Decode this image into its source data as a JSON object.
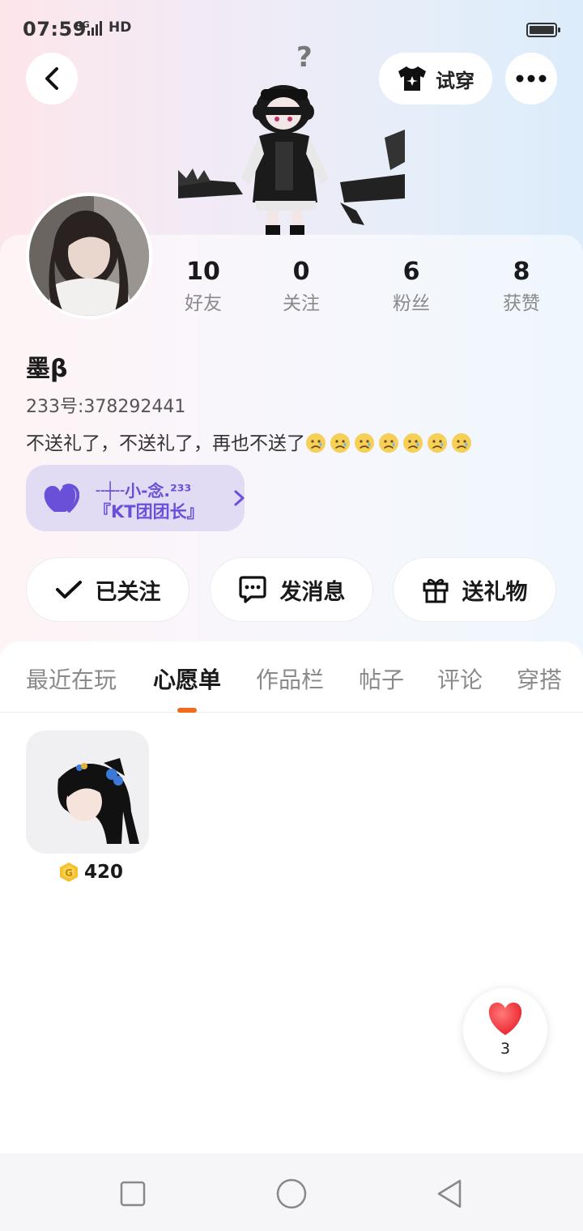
{
  "status_bar": {
    "time": "07:59",
    "network": "4G",
    "hd": "HD"
  },
  "header": {
    "back_icon": "chevron-left-icon",
    "tryon_label": "试穿",
    "tryon_icon": "tshirt-icon",
    "more_icon": "more-dots-icon"
  },
  "profile": {
    "stats": [
      {
        "value": "10",
        "label": "好友"
      },
      {
        "value": "0",
        "label": "关注"
      },
      {
        "value": "6",
        "label": "粉丝"
      },
      {
        "value": "8",
        "label": "获赞"
      }
    ],
    "username": "墨β",
    "uid": "233号:378292441",
    "bio": "不送礼了，不送礼了，再也不送了",
    "bio_emoji_count": 7,
    "tag": {
      "line1": "╌┼╌小-念.²³³",
      "line2": "『KT团团长』",
      "color": "#6a4fd8"
    }
  },
  "actions": [
    {
      "label": "已关注",
      "icon": "check-icon"
    },
    {
      "label": "发消息",
      "icon": "message-icon"
    },
    {
      "label": "送礼物",
      "icon": "gift-icon"
    }
  ],
  "tabs": [
    {
      "label": "最近在玩",
      "active": false
    },
    {
      "label": "心愿单",
      "active": true
    },
    {
      "label": "作品栏",
      "active": false
    },
    {
      "label": "帖子",
      "active": false
    },
    {
      "label": "评论",
      "active": false
    },
    {
      "label": "穿搭",
      "active": false
    }
  ],
  "wishlist": [
    {
      "price": "420",
      "currency_icon": "coin-icon"
    }
  ],
  "like_fab": {
    "count": "3",
    "color": "#f03a3a"
  },
  "accent_color": "#f26a1b"
}
